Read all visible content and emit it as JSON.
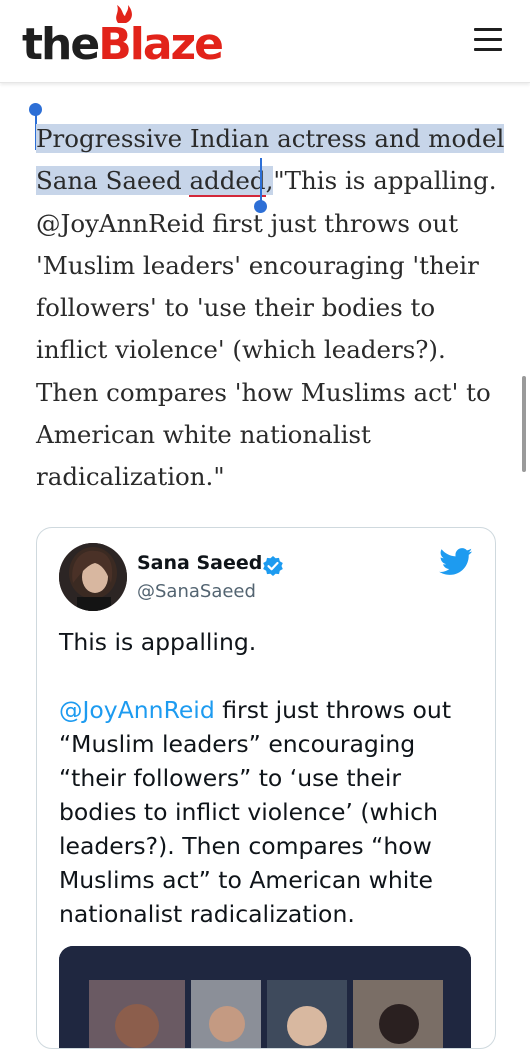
{
  "header": {
    "logo_the": "the",
    "logo_blaze": "Blaze",
    "menu_icon": "hamburger-menu-icon"
  },
  "article": {
    "selected_line1": "Progressive Indian actress and model",
    "selected_line2": "Sana Saeed",
    "link_text": "added",
    "sep": ",",
    "rest": "\"This is appalling. @JoyAnnReid first just throws out 'Muslim leaders' encouraging 'their followers' to 'use their bodies to inflict violence' (which leaders?). Then compares 'how Muslims act' to American white nationalist radicalization.\""
  },
  "tweet": {
    "name": "Sana Saeed",
    "handle": "@SanaSaeed",
    "verified_icon": "verified-badge-icon",
    "brand_icon": "twitter-bird-icon",
    "para1": "This is appalling.",
    "mention": "@JoyAnnReid",
    "para2_rest": " first just throws out “Muslim leaders” encouraging “their followers” to ‘use their bodies to inflict violence’ (which leaders?). Then compares “how Muslims act”  to American white nationalist radicalization.",
    "colors": {
      "accent": "#1d9bf0",
      "text": "#0f1419",
      "muted": "#536471"
    }
  },
  "colors": {
    "brand": "#e2231a",
    "link_underline": "#d3283a",
    "selection": "#c7d5e9",
    "handles": "#2d6fd6"
  }
}
